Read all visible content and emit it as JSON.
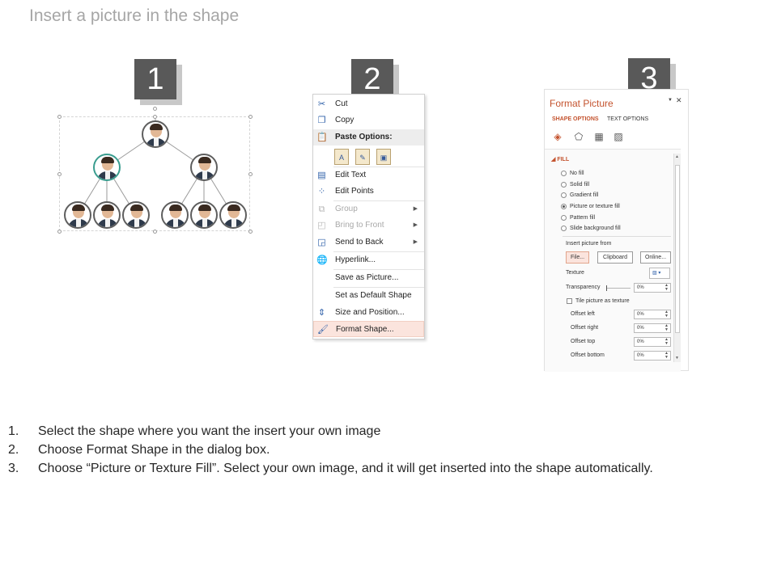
{
  "title": "Insert a picture in the shape",
  "steps": [
    "1",
    "2",
    "3"
  ],
  "context_menu": {
    "items": [
      {
        "label": "Cut",
        "icon": "scissors-icon",
        "disabled": false
      },
      {
        "label": "Copy",
        "icon": "copy-icon",
        "disabled": false
      },
      {
        "label": "Paste Options:",
        "icon": "paste-icon",
        "disabled": false
      },
      {
        "label": "Edit Text",
        "icon": "edit-text-icon",
        "disabled": false
      },
      {
        "label": "Edit Points",
        "icon": "edit-points-icon",
        "disabled": false
      },
      {
        "label": "Group",
        "icon": "group-icon",
        "disabled": true,
        "submenu": true
      },
      {
        "label": "Bring to Front",
        "icon": "bring-front-icon",
        "disabled": true,
        "submenu": true
      },
      {
        "label": "Send to Back",
        "icon": "send-back-icon",
        "disabled": false,
        "submenu": true
      },
      {
        "label": "Hyperlink...",
        "icon": "hyperlink-icon",
        "disabled": false
      },
      {
        "label": "Save as Picture...",
        "icon": "",
        "disabled": false
      },
      {
        "label": "Set as Default Shape",
        "icon": "",
        "disabled": false
      },
      {
        "label": "Size and Position...",
        "icon": "size-position-icon",
        "disabled": false
      },
      {
        "label": "Format Shape...",
        "icon": "format-shape-icon",
        "disabled": false,
        "highlighted": true
      }
    ]
  },
  "format_pane": {
    "title": "Format Picture",
    "tabs": [
      "SHAPE OPTIONS",
      "TEXT OPTIONS"
    ],
    "section": "FILL",
    "fill_options": [
      {
        "label": "No fill",
        "selected": false
      },
      {
        "label": "Solid fill",
        "selected": false
      },
      {
        "label": "Gradient fill",
        "selected": false
      },
      {
        "label": "Picture or texture fill",
        "selected": true
      },
      {
        "label": "Pattern fill",
        "selected": false
      },
      {
        "label": "Slide background fill",
        "selected": false
      }
    ],
    "insert_from_label": "Insert picture from",
    "buttons": [
      "File...",
      "Clipboard",
      "Online..."
    ],
    "texture_label": "Texture",
    "transparency_label": "Transparency",
    "transparency_value": "0%",
    "tile_label": "Tile picture as texture",
    "offsets": [
      {
        "label": "Offset left",
        "value": "0%"
      },
      {
        "label": "Offset right",
        "value": "0%"
      },
      {
        "label": "Offset top",
        "value": "0%"
      },
      {
        "label": "Offset bottom",
        "value": "0%"
      }
    ]
  },
  "instructions": [
    {
      "num": "1.",
      "text": "Select the shape where you want the insert your own image"
    },
    {
      "num": "2.",
      "text": "Choose Format Shape in the dialog box."
    },
    {
      "num": "3.",
      "text": "Choose “Picture or Texture Fill”. Select your own image, and it will get inserted into the shape automatically."
    }
  ],
  "colors": {
    "accent": "#c4532e",
    "badge": "#595959",
    "highlight": "#fbe4dd"
  }
}
